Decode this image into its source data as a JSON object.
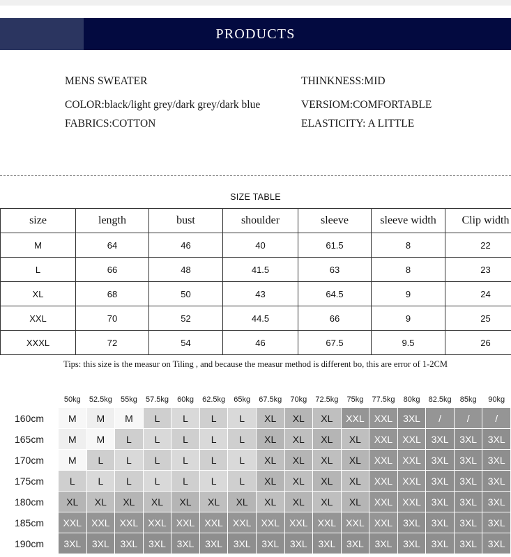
{
  "banner": {
    "title": "PRODUCTS",
    "bg_color": "#030a40",
    "accent_color": "#2b3560"
  },
  "specs": {
    "left": [
      "MENS SWEATER",
      "COLOR:black/light grey/dark grey/dark blue",
      "FABRICS:COTTON"
    ],
    "right": [
      "THINKNESS:MID",
      "VERSIOM:COMFORTABLE",
      "ELASTICITY: A LITTLE"
    ]
  },
  "size_table": {
    "title": "SIZE TABLE",
    "headers": [
      "size",
      "length",
      "bust",
      "shoulder",
      "sleeve",
      "sleeve width",
      "Clip width"
    ],
    "rows": [
      [
        "M",
        "64",
        "46",
        "40",
        "61.5",
        "8",
        "22"
      ],
      [
        "L",
        "66",
        "48",
        "41.5",
        "63",
        "8",
        "23"
      ],
      [
        "XL",
        "68",
        "50",
        "43",
        "64.5",
        "9",
        "24"
      ],
      [
        "XXL",
        "70",
        "52",
        "44.5",
        "66",
        "9",
        "25"
      ],
      [
        "XXXL",
        "72",
        "54",
        "46",
        "67.5",
        "9.5",
        "26"
      ]
    ]
  },
  "tips": "Tips: this size is the measur on Tiling , and because the measur method is different bo, this are error of 1-2CM",
  "recommendation": {
    "weights": [
      "50kg",
      "52.5kg",
      "55kg",
      "57.5kg",
      "60kg",
      "62.5kg",
      "65kg",
      "67.5kg",
      "70kg",
      "72.5kg",
      "75kg",
      "77.5kg",
      "80kg",
      "82.5kg",
      "85kg",
      "90kg"
    ],
    "heights": [
      "160cm",
      "165cm",
      "170cm",
      "175cm",
      "180cm",
      "185cm",
      "190cm"
    ],
    "matrix": [
      [
        "M",
        "M",
        "M",
        "L",
        "L",
        "L",
        "L",
        "XL",
        "XL",
        "XL",
        "XXL",
        "XXL",
        "3XL",
        "/",
        "/",
        "/"
      ],
      [
        "M",
        "M",
        "L",
        "L",
        "L",
        "L",
        "L",
        "XL",
        "XL",
        "XL",
        "XL",
        "XXL",
        "XXL",
        "3XL",
        "3XL",
        "3XL"
      ],
      [
        "M",
        "L",
        "L",
        "L",
        "L",
        "L",
        "L",
        "XL",
        "XL",
        "XL",
        "XL",
        "XXL",
        "XXL",
        "3XL",
        "3XL",
        "3XL"
      ],
      [
        "L",
        "L",
        "L",
        "L",
        "L",
        "L",
        "L",
        "XL",
        "XL",
        "XL",
        "XL",
        "XXL",
        "XXL",
        "3XL",
        "3XL",
        "3XL"
      ],
      [
        "XL",
        "XL",
        "XL",
        "XL",
        "XL",
        "XL",
        "XL",
        "XL",
        "XL",
        "XL",
        "XL",
        "XXL",
        "XXL",
        "3XL",
        "3XL",
        "3XL"
      ],
      [
        "XXL",
        "XXL",
        "XXL",
        "XXL",
        "XXL",
        "XXL",
        "XXL",
        "XXL",
        "XXL",
        "XXL",
        "XXL",
        "XXL",
        "3XL",
        "3XL",
        "3XL",
        "3XL"
      ],
      [
        "3XL",
        "3XL",
        "3XL",
        "3XL",
        "3XL",
        "3XL",
        "3XL",
        "3XL",
        "3XL",
        "3XL",
        "3XL",
        "3XL",
        "3XL",
        "3XL",
        "3XL",
        "3XL"
      ]
    ],
    "shade_colors": {
      "M": "#f7f7f7",
      "L": "#d9d9d9",
      "XL": "#b5b5b5",
      "XXL": "#959595",
      "3XL": "#8e8e8e"
    }
  }
}
